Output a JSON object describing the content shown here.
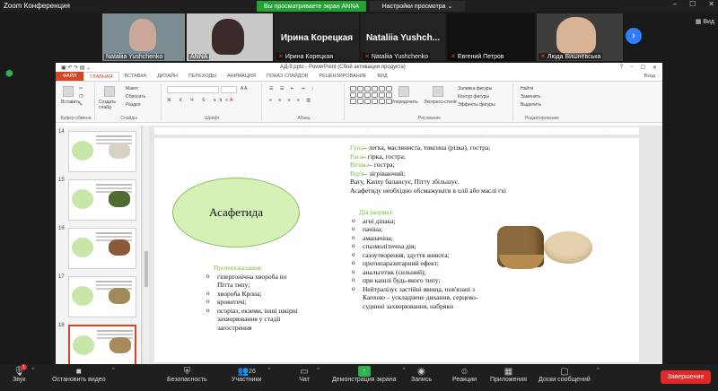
{
  "window": {
    "title": "Zoom Конференция",
    "controls": [
      "−",
      "☐",
      "✕"
    ]
  },
  "banner": {
    "share_text": "Вы просматриваете экран ANNA",
    "view_options": "Настройки просмотра ⌄"
  },
  "participants": [
    {
      "name": "Nataliia Yushchenko",
      "video": true,
      "muted": false
    },
    {
      "name": "ANNA",
      "video": true,
      "muted": false
    },
    {
      "name": "Ирина Корецкая",
      "bigname": "Ирина Корецкая",
      "video": false,
      "muted": true
    },
    {
      "name": "Nataliia Yushchenko",
      "bigname": "Nataliia Yushch...",
      "video": false,
      "muted": true
    },
    {
      "name": "Евгений Петров",
      "video": false,
      "muted": true
    },
    {
      "name": "Люда Вишневська",
      "video": true,
      "muted": true
    }
  ],
  "view_button": "Вид",
  "ppt": {
    "title": "АД-9.pptx - PowerPoint (Сбой активации продукта)",
    "tabs": [
      "ФАЙЛ",
      "ГЛАВНАЯ",
      "ВСТАВКА",
      "ДИЗАЙН",
      "ПЕРЕХОДЫ",
      "АНИМАЦИЯ",
      "ПОКАЗ СЛАЙДОВ",
      "РЕЦЕНЗИРОВАНИЕ",
      "ВИД"
    ],
    "login": "Вход",
    "ribbon": {
      "clipboard": "Буфер обмена",
      "slides": "Слайды",
      "font": "Шрифт",
      "paragraph": "Абзац",
      "drawing": "Рисование",
      "editing": "Редактирование",
      "insert": "Вставить",
      "create_slide": "Создать слайд",
      "layout": "Макет",
      "reset": "Сбросить",
      "section": "Раздел",
      "arrange": "Упорядочить",
      "quick_styles": "Экспресс-стили",
      "fill": "Заливка фигуры",
      "outline": "Контур фигуры",
      "effects": "Эффекты фигуры",
      "find": "Найти",
      "replace": "Заменить",
      "select": "Выделить"
    },
    "thumbs": [
      "14",
      "15",
      "16",
      "17",
      "18"
    ]
  },
  "slide": {
    "title": "Асафетида",
    "gunas": [
      {
        "key": "Гуна",
        "text": "– легка, масляниста, тиксина (різка), гостра;"
      },
      {
        "key": "Раса",
        "text": "– гірка, гостра;"
      },
      {
        "key": "Віпака",
        "text": "– гостра;"
      },
      {
        "key": "Вір'я",
        "text": "– зігріваючий;"
      }
    ],
    "line1": "Вату, Капху балансує, Пітту збільшує.",
    "line2": "Асафетиду необхідно обсмажувати в олії або маслі гхі",
    "action_title": "Дія (корма):",
    "actions": [
      "агні діпака;",
      "пачіна;",
      "амапачіна;",
      "спазмолітична дія;",
      "газоутворення,             здуття живота;",
      "протипаразитарний ефект;",
      "анальгетик (сильний);",
      "при кашлі будь-якого типу;",
      "Нейтралізує  застійні  явища, пов'язані    з    Капхою    –    ускладнене             дихання, серцево-судинні захворювання, набряки"
    ],
    "contra_title": "Протипоказання:",
    "contra": [
      "гіпертонічна хвороба по Пітта типу;",
      "хвороба Крона;",
      "кровотечі;",
      "псоріаз, екземи, інші шкірні захворювання у стадії загострення"
    ]
  },
  "toolbar": {
    "audio": "Звук",
    "video": "Остановить видео",
    "security": "Безопасность",
    "participants": "Участники",
    "participants_count": "26",
    "chat": "Чат",
    "share": "Демонстрация экрана",
    "record": "Запись",
    "reactions": "Реакции",
    "apps": "Приложения",
    "whiteboard": "Доски сообщений",
    "end": "Завершение",
    "audio_badge": "1"
  },
  "colors": {
    "accent_green": "#23a336",
    "ppt_orange": "#d24726",
    "end_red": "#e02828",
    "zoom_blue": "#2f7dff"
  }
}
